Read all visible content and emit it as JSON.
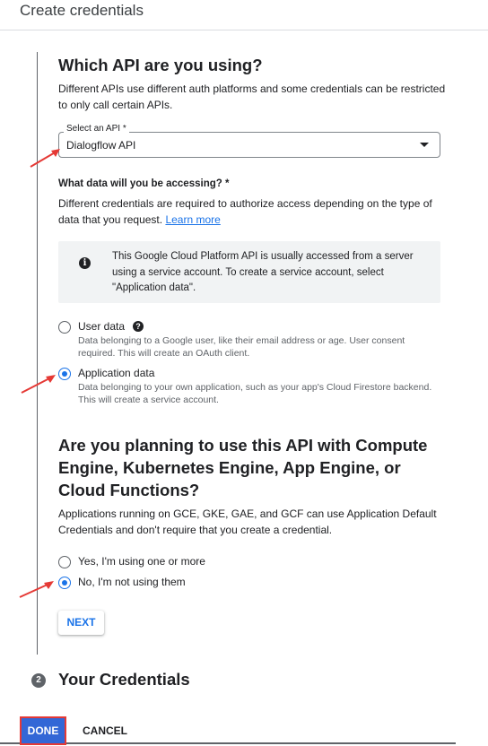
{
  "header": {
    "title": "Create credentials"
  },
  "api_section": {
    "heading": "Which API are you using?",
    "description": "Different APIs use different auth platforms and some credentials can be restricted to only call certain APIs.",
    "select_label": "Select an API *",
    "select_value": "Dialogflow API"
  },
  "data_section": {
    "label": "What data will you be accessing? *",
    "description": "Different credentials are required to authorize access depending on the type of data that you request.",
    "learn_more": "Learn more",
    "info_text": "This Google Cloud Platform API is usually accessed from a server using a service account. To create a service account, select \"Application data\".",
    "options": [
      {
        "label": "User data",
        "description": "Data belonging to a Google user, like their email address or age. User consent required. This will create an OAuth client.",
        "checked": false
      },
      {
        "label": "Application data",
        "description": "Data belonging to your own application, such as your app's Cloud Firestore backend. This will create a service account.",
        "checked": true
      }
    ]
  },
  "compute_section": {
    "heading": "Are you planning to use this API with Compute Engine, Kubernetes Engine, App Engine, or Cloud Functions?",
    "description": "Applications running on GCE, GKE, GAE, and GCF can use Application Default Credentials and don't require that you create a credential.",
    "options": [
      {
        "label": "Yes, I'm using one or more",
        "checked": false
      },
      {
        "label": "No, I'm not using them",
        "checked": true
      }
    ],
    "next_label": "NEXT"
  },
  "step2": {
    "number": "2",
    "title": "Your Credentials"
  },
  "footer": {
    "done_label": "DONE",
    "cancel_label": "CANCEL"
  },
  "colors": {
    "accent": "#1a73e8",
    "done_bg": "#3367d6",
    "annotation": "#e53935"
  }
}
